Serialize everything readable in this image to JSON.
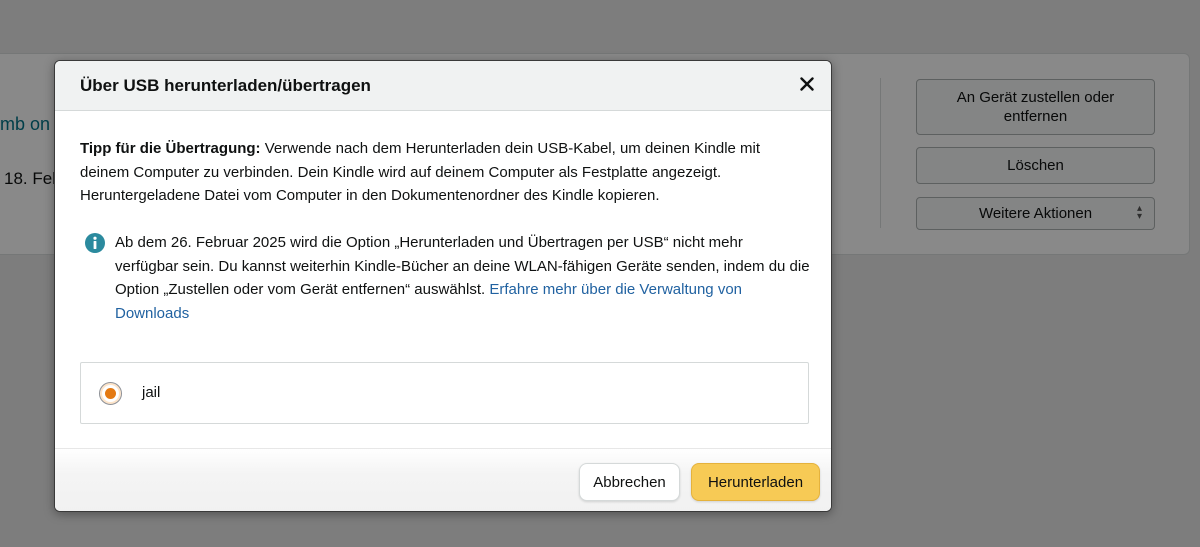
{
  "background": {
    "title_link_fragment": "mb on",
    "date_fragment": "18. Feb",
    "buttons": {
      "deliver_label": "An Gerät zustellen oder entfernen",
      "delete_label": "Löschen",
      "more_actions_label": "Weitere Aktionen"
    }
  },
  "modal": {
    "title": "Über USB herunterladen/übertragen",
    "tip": {
      "bold_prefix": "Tipp für die Übertragung:",
      "text": "Verwende nach dem Herunterladen dein USB-Kabel, um deinen Kindle mit deinem Computer zu verbinden. Dein Kindle wird auf deinem Computer als Festplatte angezeigt. Heruntergeladene Datei vom Computer in den Dokumentenordner des Kindle kopieren."
    },
    "notice": {
      "text": "Ab dem 26. Februar 2025 wird die Option „Herunterladen und Übertragen per USB“ nicht mehr verfügbar sein. Du kannst weiterhin Kindle-Bücher an deine WLAN-fähigen Geräte senden, indem du die Option „Zustellen oder vom Gerät entfernen“ auswählst.",
      "link_text": "Erfahre mehr über die Verwaltung von Downloads"
    },
    "device": {
      "name": "jail",
      "selected": true
    },
    "footer": {
      "cancel_label": "Abbrechen",
      "download_label": "Herunterladen"
    }
  },
  "colors": {
    "primary_button": "#f7ca55",
    "link": "#2162a1",
    "radio_selected": "#e47911",
    "info_icon": "#2b8a9e"
  },
  "icons": {
    "close": "close-icon",
    "info": "info-icon",
    "select_chevron": "chevron-up-down-icon"
  }
}
